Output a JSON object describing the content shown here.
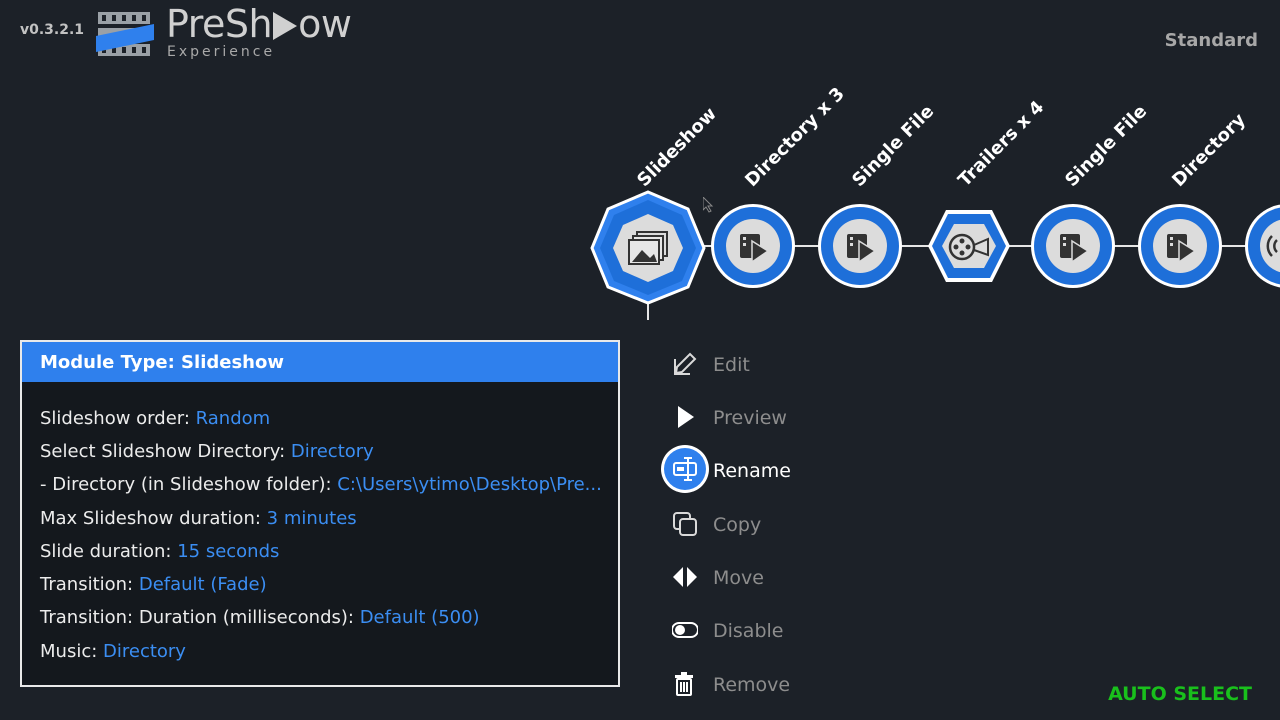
{
  "header": {
    "version": "v0.3.2.1",
    "brand_left": "Pre",
    "brand_right": "ow",
    "brand_play_letter": "Sh",
    "subtitle": "Experience",
    "mode": "Standard"
  },
  "timeline": {
    "nodes": [
      {
        "label": "Slideshow",
        "icon": "slideshow-icon",
        "selected": true
      },
      {
        "label": "Directory x 3",
        "icon": "video-file-icon"
      },
      {
        "label": "Single File",
        "icon": "video-file-icon"
      },
      {
        "label": "Trailers x 4",
        "icon": "film-reel-icon"
      },
      {
        "label": "Single File",
        "icon": "video-file-icon"
      },
      {
        "label": "Directory",
        "icon": "video-file-icon"
      },
      {
        "label": "",
        "icon": "audio-icon"
      }
    ]
  },
  "panel": {
    "title": "Module Type: Slideshow",
    "rows": [
      {
        "key": "Slideshow order: ",
        "value": "Random"
      },
      {
        "key": "Select Slideshow Directory: ",
        "value": "Directory"
      },
      {
        "key": "- Directory (in Slideshow folder): ",
        "value": "C:\\Users\\ytimo\\Desktop\\Pre..."
      },
      {
        "key": "Max Slideshow duration: ",
        "value": "3 minutes"
      },
      {
        "key": "Slide duration: ",
        "value": "15 seconds"
      },
      {
        "key": "Transition: ",
        "value": "Default (Fade)"
      },
      {
        "key": "Transition: Duration (milliseconds): ",
        "value": "Default (500)"
      },
      {
        "key": "Music: ",
        "value": "Directory"
      }
    ]
  },
  "menu": {
    "items": [
      {
        "label": "Edit",
        "icon": "edit-icon"
      },
      {
        "label": "Preview",
        "icon": "play-icon"
      },
      {
        "label": "Rename",
        "icon": "rename-icon",
        "active": true
      },
      {
        "label": "Copy",
        "icon": "copy-icon"
      },
      {
        "label": "Move",
        "icon": "move-icon"
      },
      {
        "label": "Disable",
        "icon": "toggle-icon"
      },
      {
        "label": "Remove",
        "icon": "trash-icon"
      }
    ]
  },
  "footer": {
    "auto_select": "AUTO SELECT"
  },
  "colors": {
    "background": "#1c2128",
    "accent": "#2f80ed",
    "value_text": "#3b8ef3",
    "status_green": "#19c01c"
  }
}
